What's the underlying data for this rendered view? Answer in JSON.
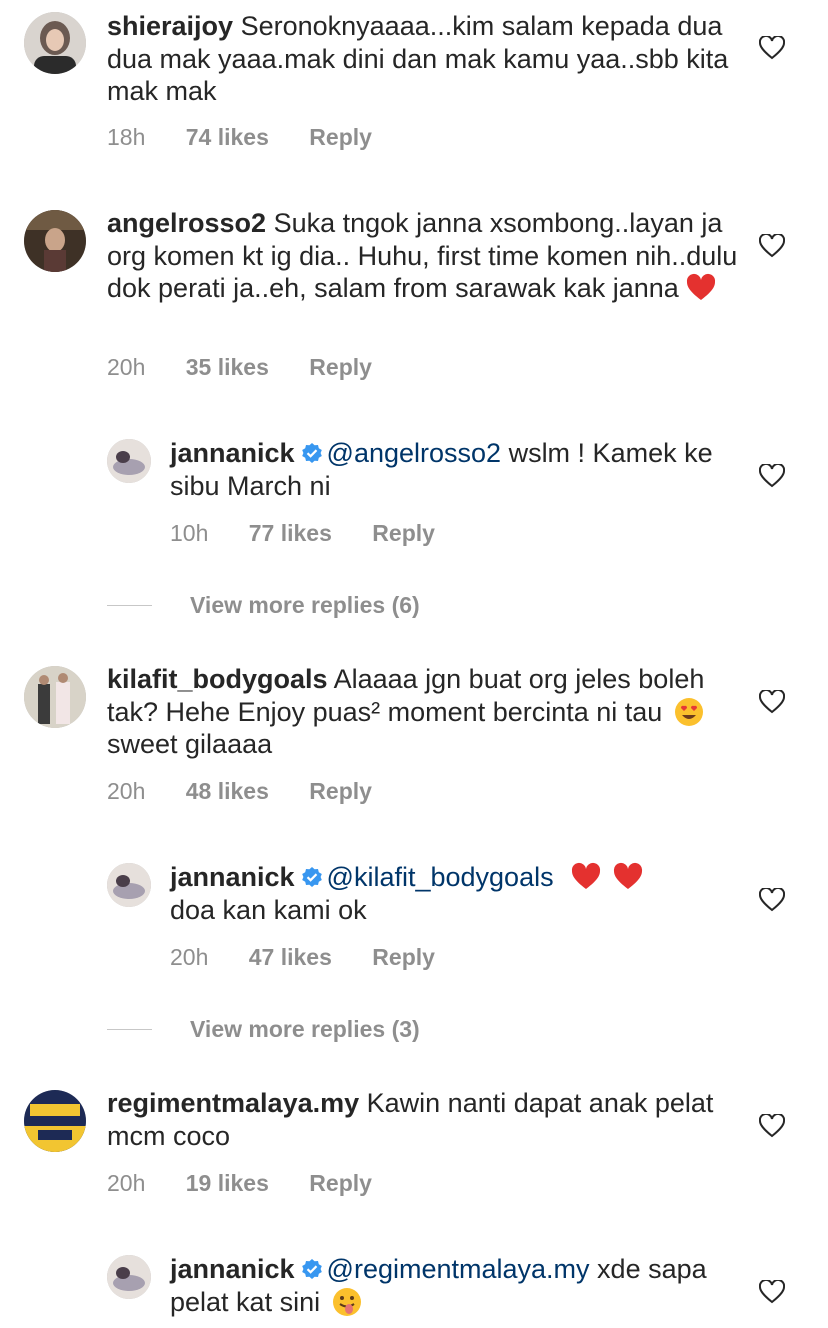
{
  "comments": [
    {
      "user": "shieraijoy",
      "text": "Seronoknyaaaa...kim salam kepada dua dua mak yaaa.mak dini dan mak  kamu yaa..sbb kita mak mak",
      "time": "18h",
      "likes": "74 likes",
      "reply": "Reply"
    },
    {
      "user": "angelrosso2",
      "text": "Suka tngok janna xsombong..layan ja org komen kt ig dia.. Huhu, first time komen nih..dulu dok perati ja..eh, salam from sarawak kak janna",
      "time": "20h",
      "likes": "35 likes",
      "reply": "Reply",
      "reply_item": {
        "user": "jannanick",
        "mention": "@angelrosso2",
        "text": " wslm ! Kamek ke sibu March ni",
        "time": "10h",
        "likes": "77 likes",
        "reply": "Reply"
      },
      "view_more": "View more replies (6)"
    },
    {
      "user": "kilafit_bodygoals",
      "text_a": "Alaaaa jgn buat org jeles boleh tak? Hehe Enjoy puas² moment bercinta ni tau",
      "text_b": " sweet gilaaaa",
      "time": "20h",
      "likes": "48 likes",
      "reply": "Reply",
      "reply_item": {
        "user": "jannanick",
        "mention": "@kilafit_bodygoals",
        "text": "doa kan kami ok",
        "time": "20h",
        "likes": "47 likes",
        "reply": "Reply"
      },
      "view_more": "View more replies (3)"
    },
    {
      "user": "regimentmalaya.my",
      "text": "Kawin nanti dapat anak pelat mcm coco",
      "time": "20h",
      "likes": "19 likes",
      "reply": "Reply",
      "reply_item": {
        "user": "jannanick",
        "mention": "@regimentmalaya.my",
        "text": " xde sapa pelat kat sini",
        "time": "",
        "likes": "",
        "reply": ""
      }
    }
  ],
  "colors": {
    "text": "#262626",
    "meta": "#8e8e8e",
    "mention": "#003569",
    "verified": "#3897f0",
    "heart_red": "#ed4956"
  }
}
